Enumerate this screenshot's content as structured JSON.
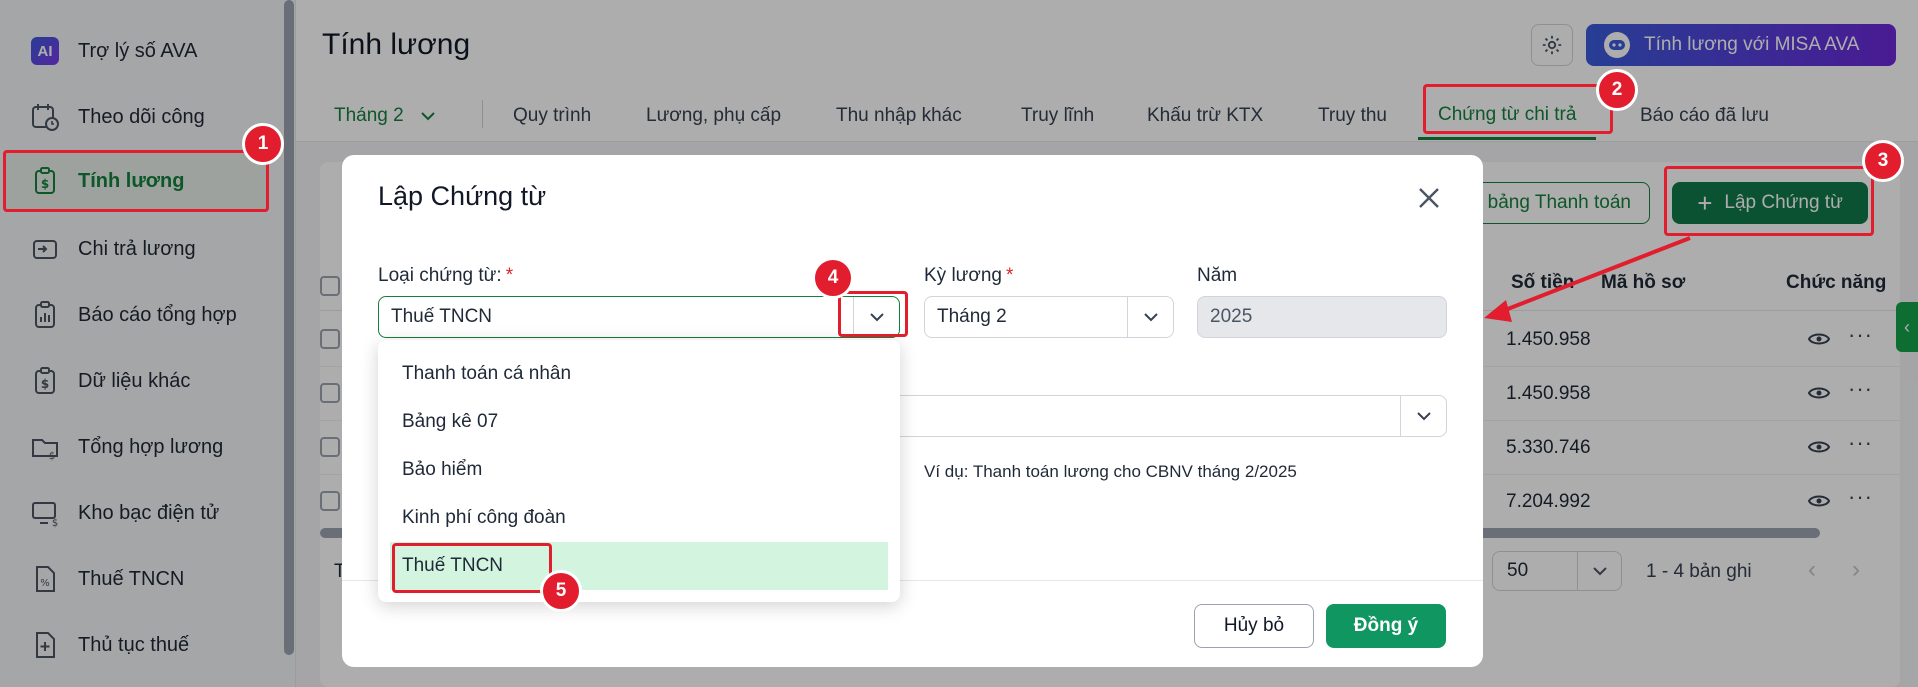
{
  "colors": {
    "brand_green": "#15803d",
    "annotation_red": "#e11d2e",
    "ava_gradient_start": "#3b5bdb",
    "ava_gradient_end": "#6d28d9"
  },
  "sidebar": {
    "items": [
      {
        "label": "Trợ lý số AVA",
        "icon": "ai-icon",
        "icon_text": "AI"
      },
      {
        "label": "Theo dõi công",
        "icon": "calendar-clock-icon"
      },
      {
        "label": "Tính lương",
        "icon": "salary-clipboard-icon",
        "active": true
      },
      {
        "label": "Chi trả lương",
        "icon": "wallet-icon"
      },
      {
        "label": "Báo cáo tổng hợp",
        "icon": "report-icon"
      },
      {
        "label": "Dữ liệu khác",
        "icon": "data-clipboard-icon"
      },
      {
        "label": "Tổng hợp lương",
        "icon": "folder-money-icon"
      },
      {
        "label": "Kho bạc điện tử",
        "icon": "monitor-money-icon"
      },
      {
        "label": "Thuế TNCN",
        "icon": "tax-file-icon"
      },
      {
        "label": "Thủ tục thuế",
        "icon": "file-plus-icon"
      }
    ]
  },
  "header": {
    "title": "Tính lương",
    "ava_button": "Tính lương với MISA AVA"
  },
  "tabs": {
    "month": "Tháng 2",
    "items": [
      "Quy trình",
      "Lương, phụ cấp",
      "Thu nhập khác",
      "Truy lĩnh",
      "Khấu trừ KTX",
      "Truy thu",
      "Chứng từ chi trả",
      "Báo cáo đã lưu"
    ],
    "active": "Chứng từ chi trả"
  },
  "toolbar": {
    "payment_sheet_button": "bảng Thanh toán",
    "create_voucher_button": "Lập Chứng từ"
  },
  "table": {
    "headers": {
      "amount": "Số tiền",
      "file_code": "Mã hồ sơ",
      "actions": "Chức năng"
    },
    "rows": [
      {
        "amount": "1.450.958"
      },
      {
        "amount": "1.450.958"
      },
      {
        "amount": "5.330.746"
      },
      {
        "amount": "7.204.992"
      }
    ],
    "footer_left": "T",
    "page_size": "50",
    "paging_text": "1 - 4 bản ghi"
  },
  "modal": {
    "title": "Lập Chứng từ",
    "voucher_type_label": "Loại chứng từ:",
    "voucher_type_value": "Thuế TNCN",
    "period_label": "Kỳ lương",
    "period_value": "Tháng 2",
    "year_label": "Năm",
    "year_value": "2025",
    "required_mark": "*",
    "hint": "Ví dụ: Thanh toán lương cho CBNV tháng 2/2025",
    "cancel_button": "Hủy bỏ",
    "ok_button": "Đồng ý",
    "dropdown_options": [
      "Thanh toán cá nhân",
      "Bảng kê 07",
      "Bảo hiểm",
      "Kinh phí công đoàn",
      "Thuế TNCN"
    ],
    "selected_option": "Thuế TNCN"
  },
  "annotations": [
    "1",
    "2",
    "3",
    "4",
    "5"
  ]
}
